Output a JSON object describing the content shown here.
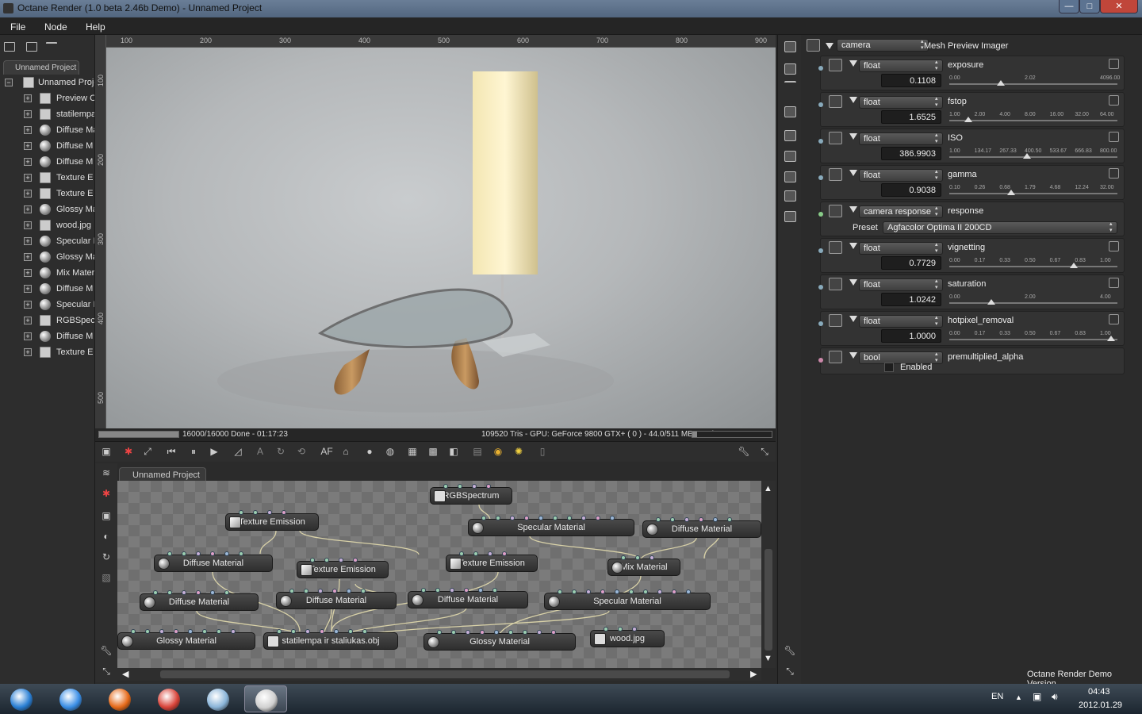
{
  "window": {
    "title": "Octane Render (1.0 beta 2.46b Demo) - Unnamed Project",
    "minimize": "—",
    "maximize": "□",
    "close": "✕"
  },
  "menu": [
    "File",
    "Node",
    "Help"
  ],
  "left_panel": {
    "tab": "Unnamed Project",
    "root": "Unnamed Proje",
    "items": [
      {
        "label": "Preview C",
        "icon": "preview-icon"
      },
      {
        "label": "statilempa",
        "icon": "mesh-icon"
      },
      {
        "label": "Diffuse Ma",
        "icon": "material-sphere-icon"
      },
      {
        "label": "Diffuse M",
        "icon": "material-sphere-icon"
      },
      {
        "label": "Diffuse M",
        "icon": "material-sphere-icon"
      },
      {
        "label": "Texture E",
        "icon": "texture-emission-icon"
      },
      {
        "label": "Texture E",
        "icon": "texture-emission-icon"
      },
      {
        "label": "Glossy Ma",
        "icon": "material-sphere-icon"
      },
      {
        "label": "wood.jpg",
        "icon": "image-icon"
      },
      {
        "label": "Specular I",
        "icon": "material-sphere-icon"
      },
      {
        "label": "Glossy Ma",
        "icon": "material-sphere-icon"
      },
      {
        "label": "Mix Mater",
        "icon": "material-sphere-icon"
      },
      {
        "label": "Diffuse M",
        "icon": "material-sphere-icon"
      },
      {
        "label": "Specular I",
        "icon": "material-sphere-icon"
      },
      {
        "label": "RGBSpect",
        "icon": "rgb-spectrum-icon"
      },
      {
        "label": "Diffuse M",
        "icon": "material-sphere-icon"
      },
      {
        "label": "Texture E",
        "icon": "texture-emission-icon"
      }
    ]
  },
  "viewport": {
    "ruler_top": [
      "100",
      "200",
      "300",
      "400",
      "500",
      "600",
      "700",
      "800",
      "900"
    ],
    "ruler_left": [
      "100",
      "200",
      "300",
      "400",
      "500"
    ],
    "status_left": "16000/16000 Done - 01:17:23",
    "status_right": "109520 Tris - GPU: GeForce 9800 GTX+ ( 0 ) - 44.0/511 MB Used",
    "progress": 1.0,
    "toolbar_text_af": "AF"
  },
  "node_graph": {
    "tab": "Unnamed Project",
    "nodes": [
      {
        "label": "RGBSpectrum",
        "icon": "sq"
      },
      {
        "label": "Texture Emission",
        "icon": "tex"
      },
      {
        "label": "Specular Material",
        "icon": "sphere"
      },
      {
        "label": "Diffuse Material",
        "icon": "sphere"
      },
      {
        "label": "Diffuse Material",
        "icon": "sphere"
      },
      {
        "label": "Texture Emission",
        "icon": "tex"
      },
      {
        "label": "Texture Emission",
        "icon": "tex"
      },
      {
        "label": "Mix Material",
        "icon": "sphere"
      },
      {
        "label": "Diffuse Material",
        "icon": "sphere"
      },
      {
        "label": "Diffuse Material",
        "icon": "sphere"
      },
      {
        "label": "Diffuse Material",
        "icon": "sphere"
      },
      {
        "label": "Specular Material",
        "icon": "sphere"
      },
      {
        "label": "Glossy Material",
        "icon": "sphere"
      },
      {
        "label": "statilempa ir staliukas.obj",
        "icon": "sq"
      },
      {
        "label": "Glossy Material",
        "icon": "sphere"
      },
      {
        "label": "wood.jpg",
        "icon": "sq"
      }
    ]
  },
  "right_panel": {
    "camera_combo": "camera",
    "camera_label": "Mesh Preview Imager",
    "params": [
      {
        "type": "float",
        "name": "exposure",
        "value": "0.1108",
        "ticks": [
          "0.00",
          "2.02",
          "4096.00"
        ],
        "knob": 0.32
      },
      {
        "type": "float",
        "name": "fstop",
        "value": "1.6525",
        "ticks": [
          "1.00",
          "2.00",
          "4.00",
          "8.00",
          "16.00",
          "32.00",
          "64.00"
        ],
        "knob": 0.12
      },
      {
        "type": "float",
        "name": "ISO",
        "value": "386.9903",
        "ticks": [
          "1.00",
          "134.17",
          "267.33",
          "400.50",
          "533.67",
          "666.83",
          "800.00"
        ],
        "knob": 0.48
      },
      {
        "type": "float",
        "name": "gamma",
        "value": "0.9038",
        "ticks": [
          "0.10",
          "0.26",
          "0.68",
          "1.79",
          "4.68",
          "12.24",
          "32.00"
        ],
        "knob": 0.38
      },
      {
        "type": "camera response",
        "name": "response",
        "preset_label": "Preset",
        "preset": "Agfacolor Optima II 200CD"
      },
      {
        "type": "float",
        "name": "vignetting",
        "value": "0.7729",
        "ticks": [
          "0.00",
          "0.17",
          "0.33",
          "0.50",
          "0.67",
          "0.83",
          "1.00"
        ],
        "knob": 0.77
      },
      {
        "type": "float",
        "name": "saturation",
        "value": "1.0242",
        "ticks": [
          "0.00",
          "2.00",
          "4.00"
        ],
        "knob": 0.26
      },
      {
        "type": "float",
        "name": "hotpixel_removal",
        "value": "1.0000",
        "ticks": [
          "0.00",
          "0.17",
          "0.33",
          "0.50",
          "0.67",
          "0.83",
          "1.00"
        ],
        "knob": 1.0
      },
      {
        "type": "bool",
        "name": "premultiplied_alpha",
        "checkbox_label": "Enabled",
        "checked": false
      }
    ],
    "footer": "Octane Render Demo Version"
  },
  "taskbar": {
    "lang": "EN",
    "time": "04:43",
    "date": "2012.01.29",
    "apps": [
      {
        "name": "start-icon",
        "color": "#2a7fd4"
      },
      {
        "name": "internet-explorer-icon",
        "color": "#3a8ee6"
      },
      {
        "name": "firefox-icon",
        "color": "#e66a1a"
      },
      {
        "name": "chrome-icon",
        "color": "#d9443a"
      },
      {
        "name": "notepad-icon",
        "color": "#8ab4d8"
      },
      {
        "name": "octane-render-icon",
        "color": "#cfcfcf"
      }
    ]
  }
}
